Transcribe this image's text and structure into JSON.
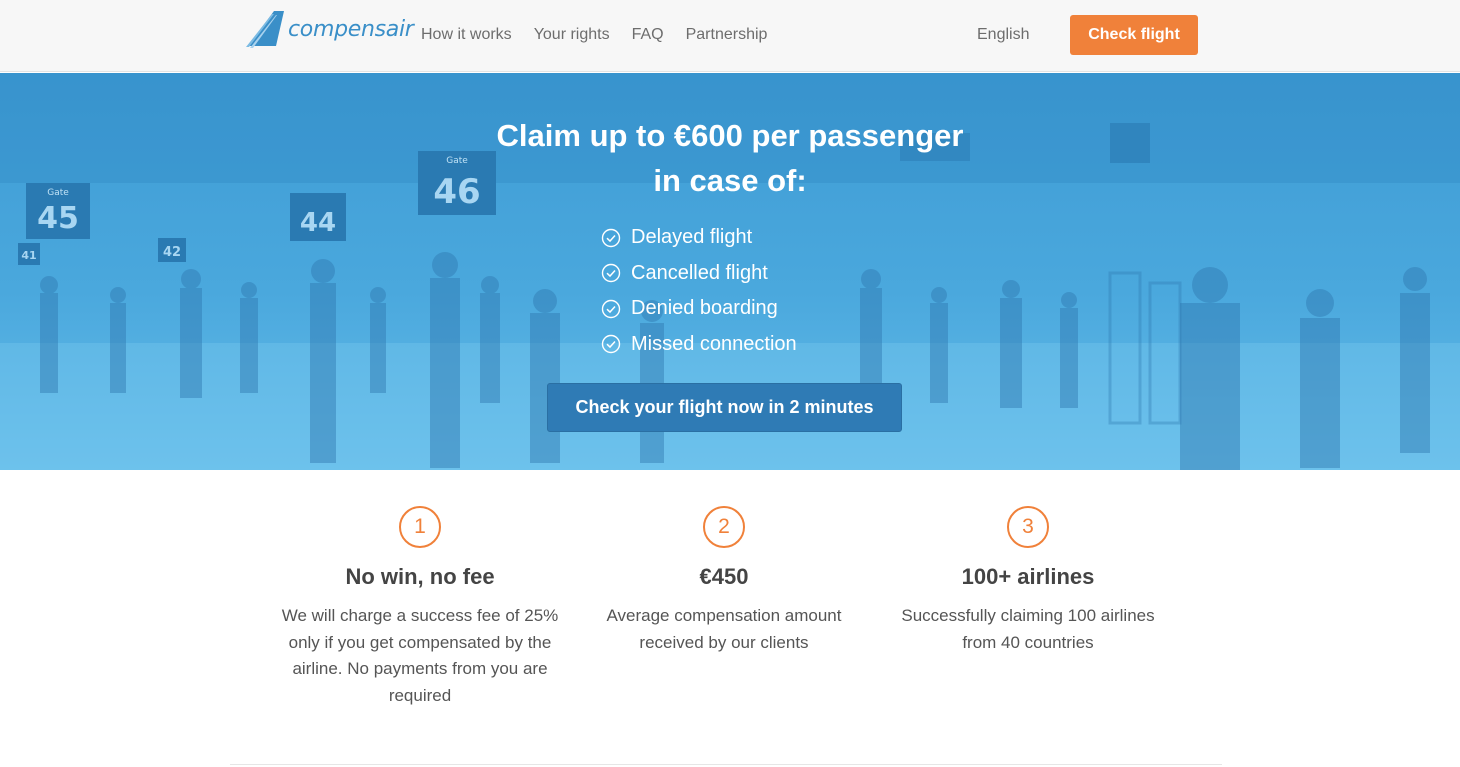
{
  "header": {
    "logo_text": "compensair",
    "nav": [
      "How it works",
      "Your rights",
      "FAQ",
      "Partnership"
    ],
    "language": "English",
    "check_flight": "Check flight",
    "colors": {
      "accent": "#f0813a",
      "brand": "#3a8fc8"
    }
  },
  "hero": {
    "title_line1": "Claim up to €600 per passenger",
    "title_line2": "in case of:",
    "items": [
      "Delayed flight",
      "Cancelled flight",
      "Denied boarding",
      "Missed connection"
    ],
    "cta": "Check your flight now in 2 minutes",
    "gate_signs": [
      "45",
      "44",
      "46",
      "42",
      "41"
    ],
    "gate_word": "Gate"
  },
  "features": [
    {
      "number": "1",
      "title": "No win, no fee",
      "description": "We will charge a success fee of 25% only if you get compensated by the airline. No payments from you are required"
    },
    {
      "number": "2",
      "title": "€450",
      "description": "Average compensation amount received by our clients"
    },
    {
      "number": "3",
      "title": "100+ airlines",
      "description": "Successfully claiming 100 airlines from 40 countries"
    }
  ]
}
